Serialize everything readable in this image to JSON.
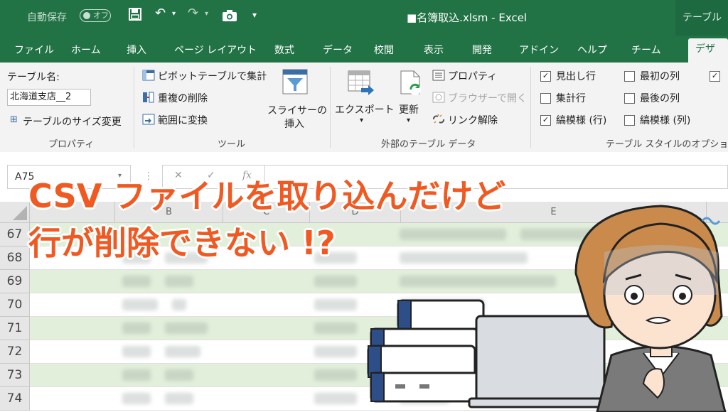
{
  "titlebar": {
    "autosave_label": "自動保存",
    "autosave_state": "オフ",
    "window_title": "■名簿取込.xlsm  -  Excel",
    "context_tab": "テーブル ツ"
  },
  "tabs": [
    "ファイル",
    "ホーム",
    "挿入",
    "ページ レイアウト",
    "数式",
    "データ",
    "校閲",
    "表示",
    "開発",
    "アドイン",
    "ヘルプ",
    "チーム",
    "デザイン"
  ],
  "ribbon": {
    "properties": {
      "table_name_label": "テーブル名:",
      "table_name_value": "北海道支店__2",
      "resize_label": "テーブルのサイズ変更",
      "group_label": "プロパティ"
    },
    "tools": {
      "pivot_label": "ピボットテーブルで集計",
      "dedupe_label": "重複の削除",
      "convert_label": "範囲に変換",
      "slicer_label_1": "スライサーの",
      "slicer_label_2": "挿入",
      "group_label": "ツール"
    },
    "external": {
      "export_label": "エクスポート",
      "refresh_label": "更新",
      "properties_label": "プロパティ",
      "browser_label": "ブラウザーで開く",
      "unlink_label": "リンク解除",
      "group_label": "外部のテーブル データ"
    },
    "style_options": {
      "header_row": "見出し行",
      "total_row": "集計行",
      "banded_rows": "縞模様 (行)",
      "first_column": "最初の列",
      "last_column": "最後の列",
      "banded_columns": "縞模様 (列)",
      "header_row_checked": true,
      "total_row_checked": false,
      "banded_rows_checked": true,
      "first_column_checked": false,
      "last_column_checked": false,
      "banded_columns_checked": false,
      "group_label": "テーブル スタイルのオプション"
    }
  },
  "formula_bar": {
    "name_box": "A75",
    "fx": "fx"
  },
  "grid": {
    "columns": [
      "B",
      "C",
      "D",
      "E"
    ],
    "rows": [
      "67",
      "68",
      "69",
      "70",
      "71",
      "72",
      "73",
      "74"
    ]
  },
  "overlay": {
    "headline_line1": "CSV ファイルを取り込んだけど",
    "headline_line2": "行が削除できない !?"
  },
  "colors": {
    "excel_green": "#217346",
    "headline": "#f05a22",
    "band": "#e2efda"
  }
}
